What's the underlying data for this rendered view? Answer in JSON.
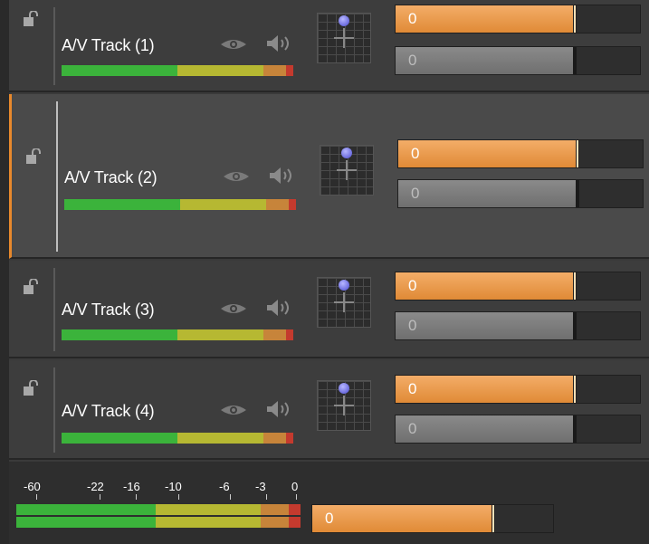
{
  "tracks": [
    {
      "name": "A/V Track (1)",
      "opacity_value": "0",
      "volume_value": "0",
      "selected": false
    },
    {
      "name": "A/V Track (2)",
      "opacity_value": "0",
      "volume_value": "0",
      "selected": true
    },
    {
      "name": "A/V Track (3)",
      "opacity_value": "0",
      "volume_value": "0",
      "selected": false
    },
    {
      "name": "A/V Track (4)",
      "opacity_value": "0",
      "volume_value": "0",
      "selected": false
    }
  ],
  "master": {
    "scale_labels": [
      "-60",
      "-22",
      "-16",
      "-10",
      "-6",
      "-3",
      "0"
    ],
    "volume_value": "0"
  },
  "icons": {
    "lock": "lock-open-icon",
    "eye": "eye-icon",
    "speaker": "speaker-icon",
    "pan": "pan-grid-icon"
  },
  "colors": {
    "accent": "#e8892c",
    "meter_green": "#3bb33b",
    "meter_yellow": "#b6b832",
    "meter_orange": "#c7843a",
    "meter_red": "#c43a2e"
  }
}
